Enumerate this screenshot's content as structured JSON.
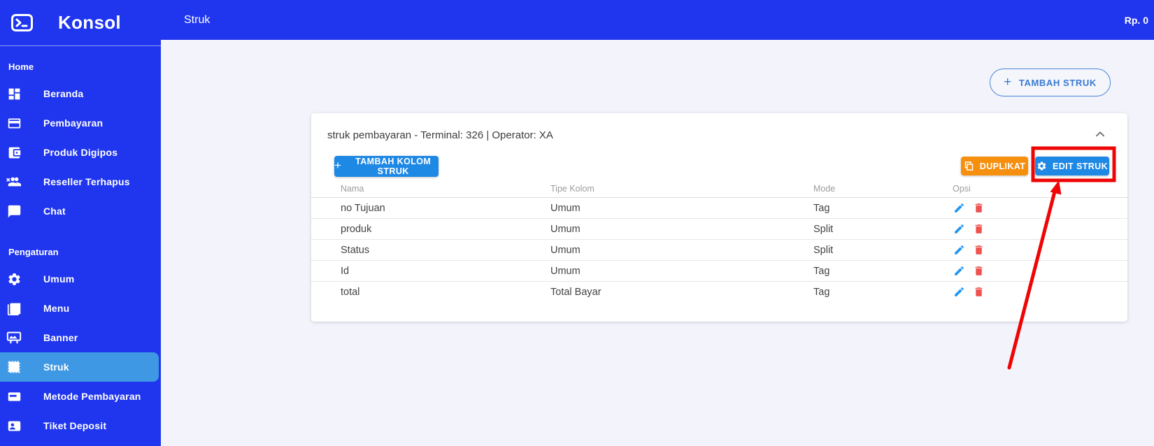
{
  "brand": {
    "name": "Konsol"
  },
  "topbar": {
    "title": "Struk",
    "balance": "Rp. 0"
  },
  "sidebar": {
    "sections": [
      {
        "label": "Home",
        "items": [
          {
            "label": "Beranda",
            "icon": "dashboard-icon"
          },
          {
            "label": "Pembayaran",
            "icon": "credit-card-icon"
          },
          {
            "label": "Produk Digipos",
            "icon": "wallet-icon"
          },
          {
            "label": "Reseller Terhapus",
            "icon": "group-remove-icon"
          },
          {
            "label": "Chat",
            "icon": "chat-icon"
          }
        ]
      },
      {
        "label": "Pengaturan",
        "items": [
          {
            "label": "Umum",
            "icon": "gear-icon"
          },
          {
            "label": "Menu",
            "icon": "collections-icon"
          },
          {
            "label": "Banner",
            "icon": "banner-icon"
          },
          {
            "label": "Struk",
            "icon": "receipt-icon",
            "active": true
          },
          {
            "label": "Metode Pembayaran",
            "icon": "payment-card-icon"
          },
          {
            "label": "Tiket Deposit",
            "icon": "contact-badge-icon"
          }
        ]
      }
    ]
  },
  "main": {
    "add_struk_label": "TAMBAH STRUK",
    "card": {
      "title": "struk pembayaran - Terminal: 326 | Operator: XA",
      "add_column_label": "TAMBAH KOLOM STRUK",
      "duplicate_label": "DUPLIKAT",
      "edit_label": "EDIT STRUK",
      "table": {
        "headers": [
          "Nama",
          "Tipe Kolom",
          "Mode",
          "Opsi"
        ],
        "rows": [
          {
            "nama": "no Tujuan",
            "tipe": "Umum",
            "mode": "Tag"
          },
          {
            "nama": "produk",
            "tipe": "Umum",
            "mode": "Split"
          },
          {
            "nama": "Status",
            "tipe": "Umum",
            "mode": "Split"
          },
          {
            "nama": "Id",
            "tipe": "Umum",
            "mode": "Tag"
          },
          {
            "nama": "total",
            "tipe": "Total Bayar",
            "mode": "Tag"
          }
        ]
      }
    }
  },
  "colors": {
    "brand_blue": "#1f35ee",
    "active_item_blue": "#3f98e4",
    "primary_button_blue": "#1e88e5",
    "duplicate_orange": "#f78f0e",
    "outline_button_blue": "#3a79d2",
    "edit_pencil_blue": "#2196f3",
    "delete_red": "#ef5350",
    "annotation_red": "#ee0505",
    "page_background": "#f2f3fb"
  }
}
